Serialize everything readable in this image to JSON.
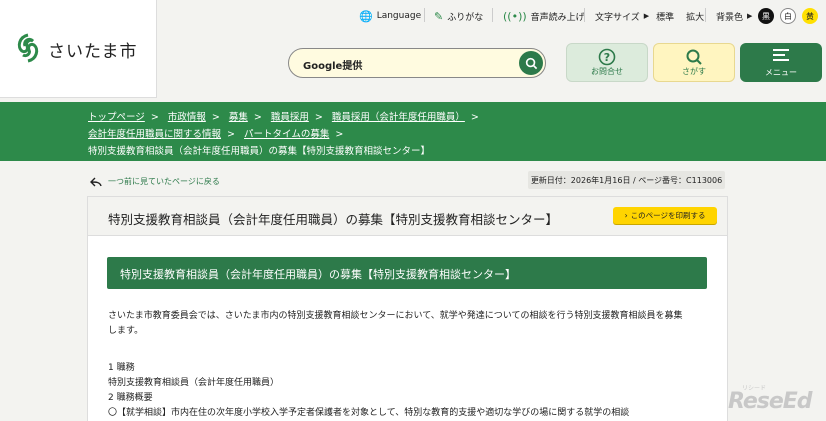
{
  "header": {
    "logo_text": "さいたま市",
    "language": "Language",
    "furigana": "ふりがな",
    "voice": "音声読み上げ",
    "font_size_label": "文字サイズ",
    "font_standard": "標準",
    "font_large": "拡大",
    "bg_color_label": "背景色",
    "bg_black": "黒",
    "bg_white": "白",
    "bg_yellow": "黄",
    "search_label": "Google提供",
    "contact": "お問合せ",
    "find": "さがす",
    "menu": "メニュー",
    "colors": {
      "green": "#2d8a4a",
      "yellow": "#ffd400"
    }
  },
  "breadcrumb": {
    "items": [
      "トップページ",
      "市政情報",
      "募集",
      "職員採用",
      "職員採用（会計年度任用職員）",
      "会計年度任用職員に関する情報",
      "パートタイムの募集"
    ],
    "current": "特別支援教育相談員（会計年度任用職員）の募集【特別支援教育相談センター】"
  },
  "nav": {
    "back": "一つ前に見ていたページに戻る",
    "meta": "更新日付：2026年1月16日 / ページ番号：C113006"
  },
  "content": {
    "title": "特別支援教育相談員（会計年度任用職員）の募集【特別支援教育相談センター】",
    "print": "このページを印刷する",
    "heading": "特別支援教育相談員（会計年度任用職員）の募集【特別支援教育相談センター】",
    "intro_1": "さいたま市教育委員会では、さいたま市内の特別支援教育相談センターにおいて、就学や発達についての相談を行う特別支援教育相談員を募集",
    "intro_2": "します。",
    "s1_title": "1 職務",
    "s1_body": "特別支援教育相談員（会計年度任用職員）",
    "s2_title": "2 職務概要",
    "s2_item": "〇【就学相談】市内在住の次年度小学校入学予定者保護者を対象として、特別な教育的支援や適切な学びの場に関する就学の相談"
  }
}
